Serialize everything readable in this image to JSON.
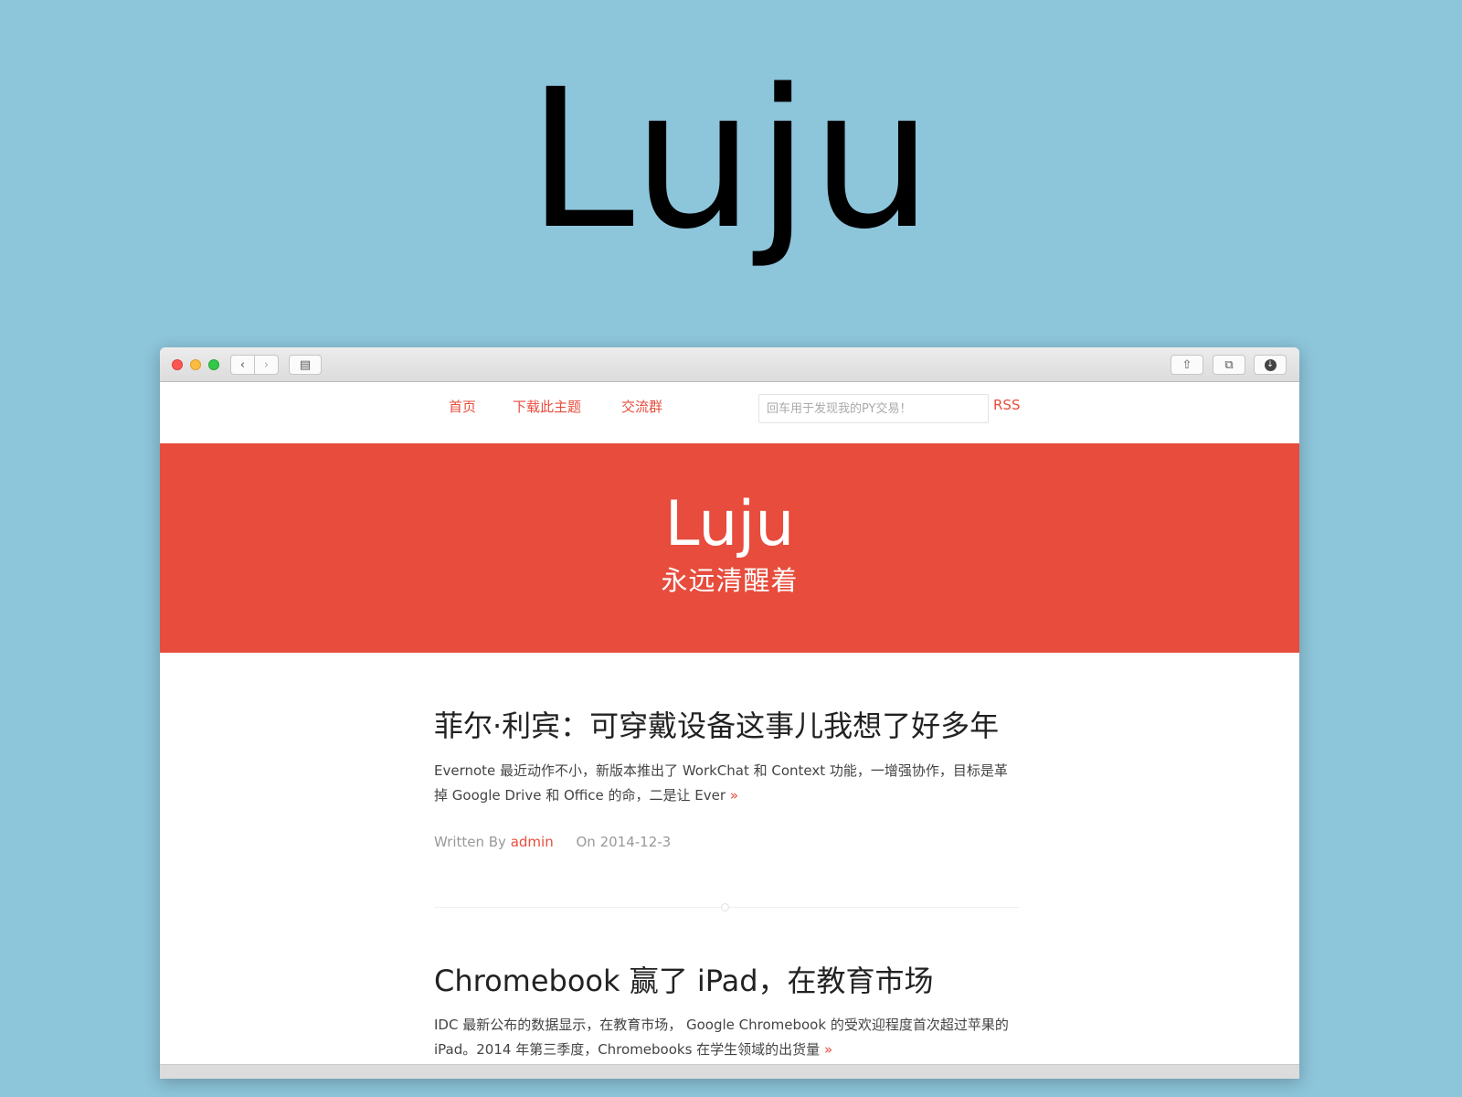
{
  "hero": {
    "title": "Luju"
  },
  "browser": {
    "toolbar": {
      "back_glyph": "‹",
      "forward_glyph": "›",
      "sidebar_glyph": "▤",
      "share_glyph": "⇧",
      "tabs_glyph": "⧉",
      "download_glyph": "↓"
    }
  },
  "nav": {
    "items": [
      {
        "label": "首页"
      },
      {
        "label": "下载此主题"
      },
      {
        "label": "交流群"
      }
    ],
    "search_placeholder": "回车用于发现我的PY交易！",
    "rss_label": "RSS"
  },
  "banner": {
    "title": "Luju",
    "subtitle": "永远清醒着"
  },
  "posts": [
    {
      "title": "菲尔·利宾：可穿戴设备这事儿我想了好多年",
      "excerpt": "Evernote 最近动作不小，新版本推出了 WorkChat 和 Context 功能，一增强协作，目标是革掉 Google Drive 和 Office 的命，二是让 Ever",
      "more": "»",
      "written_by": "Written By",
      "author": "admin",
      "date": "On 2014-12-3"
    },
    {
      "title": "Chromebook 赢了 iPad，在教育市场",
      "excerpt": "IDC 最新公布的数据显示，在教育市场， Google Chromebook 的受欢迎程度首次超过苹果的 iPad。2014 年第三季度，Chromebooks 在学生领域的出货量",
      "more": "»"
    }
  ],
  "colors": {
    "background": "#8dc5da",
    "accent": "#e74c3c"
  },
  "icons": [
    "close-light",
    "minimize-light",
    "zoom-light",
    "back-icon",
    "forward-icon",
    "sidebar-icon",
    "share-icon",
    "tabs-icon",
    "download-icon"
  ]
}
